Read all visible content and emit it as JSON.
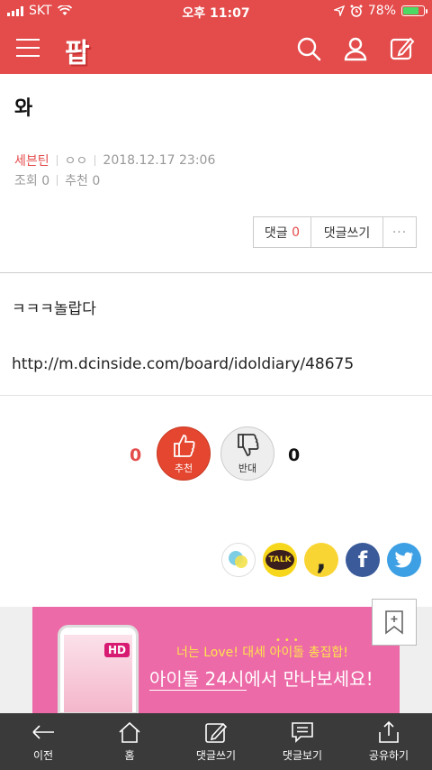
{
  "status_bar": {
    "carrier": "SKT",
    "time": "오후 11:07",
    "battery": "78%",
    "battery_level": 0.78
  },
  "header": {
    "logo": "팝"
  },
  "post": {
    "title": "와",
    "author": "세븐틴",
    "nickname": "ㅇㅇ",
    "date": "2018.12.17 23:06",
    "views": "조회 0",
    "recommends": "추천 0",
    "body": "ㅋㅋㅋ놀랍다",
    "link": "http://m.dcinside.com/board/idoldiary/48675"
  },
  "actions": {
    "comment_label": "댓글",
    "comment_count": "0",
    "write_comment": "댓글쓰기",
    "more": "···"
  },
  "votes": {
    "up_count": "0",
    "up_label": "추천",
    "down_label": "반대",
    "down_count": "0"
  },
  "share": {
    "kakao_label": "TALK"
  },
  "ad": {
    "badge": "HD",
    "line1": "너는 Love! 대세 아이돌 총집합!",
    "line2": "아이돌 24시에서 만나보세요!"
  },
  "bottom_nav": [
    {
      "label": "이전"
    },
    {
      "label": "홈"
    },
    {
      "label": "댓글쓰기"
    },
    {
      "label": "댓글보기"
    },
    {
      "label": "공유하기"
    }
  ]
}
